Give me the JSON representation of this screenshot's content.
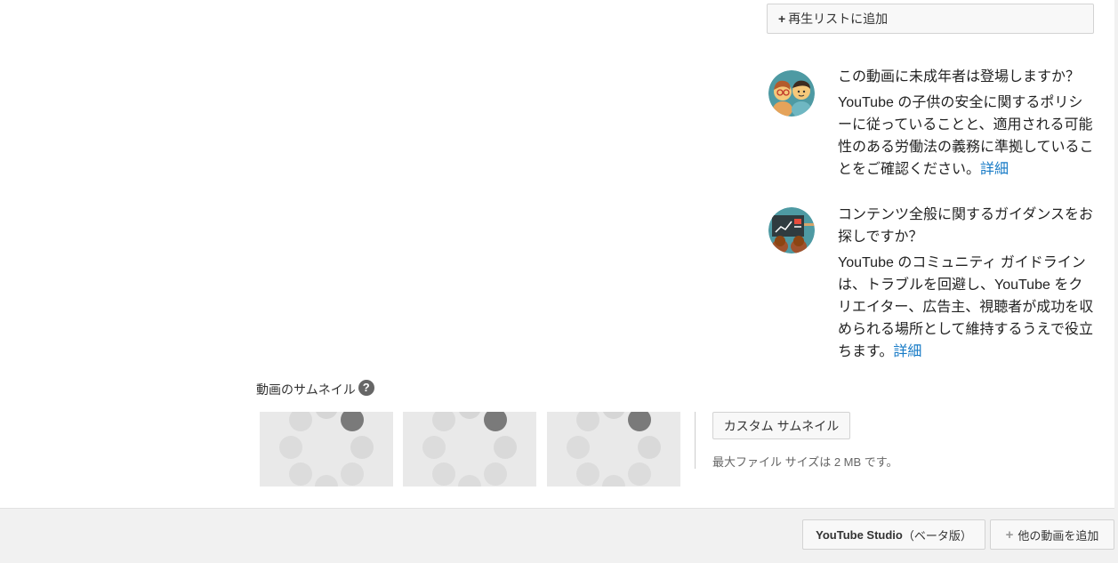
{
  "playlist": {
    "plus": "+",
    "label": "再生リストに追加"
  },
  "info_minors": {
    "title": "この動画に未成年者は登場しますか？",
    "body": "YouTube の子供の安全に関するポリシーに従っていることと、適用される可能性のある労働法の義務に準拠していることをご確認ください。",
    "link": "詳細"
  },
  "info_guidance": {
    "title": "コンテンツ全般に関するガイダンスをお探しですか？",
    "body": "YouTube のコミュニティ ガイドラインは、トラブルを回避し、YouTube をクリエイター、広告主、視聴者が成功を収められる場所として維持するうえで役立ちます。",
    "link": "詳細"
  },
  "thumbnails": {
    "label": "動画のサムネイル",
    "help": "?",
    "custom_button": "カスタム サムネイル",
    "max_size": "最大ファイル サイズは 2 MB です。"
  },
  "footer": {
    "studio_label": "YouTube Studio",
    "studio_suffix": "（ベータ版）",
    "add_plus": "+",
    "add_label": "他の動画を追加"
  }
}
